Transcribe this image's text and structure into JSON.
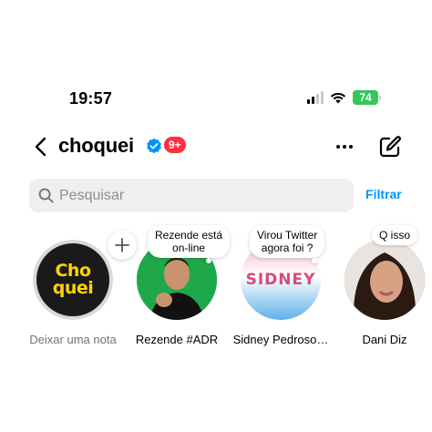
{
  "status_bar": {
    "time": "19:57",
    "battery": "74"
  },
  "header": {
    "title": "choquei",
    "badge": "9+"
  },
  "search": {
    "placeholder": "Pesquisar",
    "filter_label": "Filtrar"
  },
  "notes": [
    {
      "name": "Deixar uma nota",
      "logo_line1": "Cho",
      "logo_line2": "quei",
      "add_symbol": "+"
    },
    {
      "name": "Rezende #ADR",
      "note_line1": "Rezende está",
      "note_line2": "on-line"
    },
    {
      "name": "Sidney Pedroso…",
      "note_line1": "Virou Twitter",
      "note_line2": "agora foi ?",
      "logo_text": "SIDNEY"
    },
    {
      "name": "Dani Diz",
      "note_line1": "Q isso"
    }
  ],
  "colors": {
    "accent": "#0095f6",
    "badge": "#ff3040",
    "battery": "#34c759",
    "verified": "#0095f6",
    "logo_yellow": "#ffd400"
  }
}
